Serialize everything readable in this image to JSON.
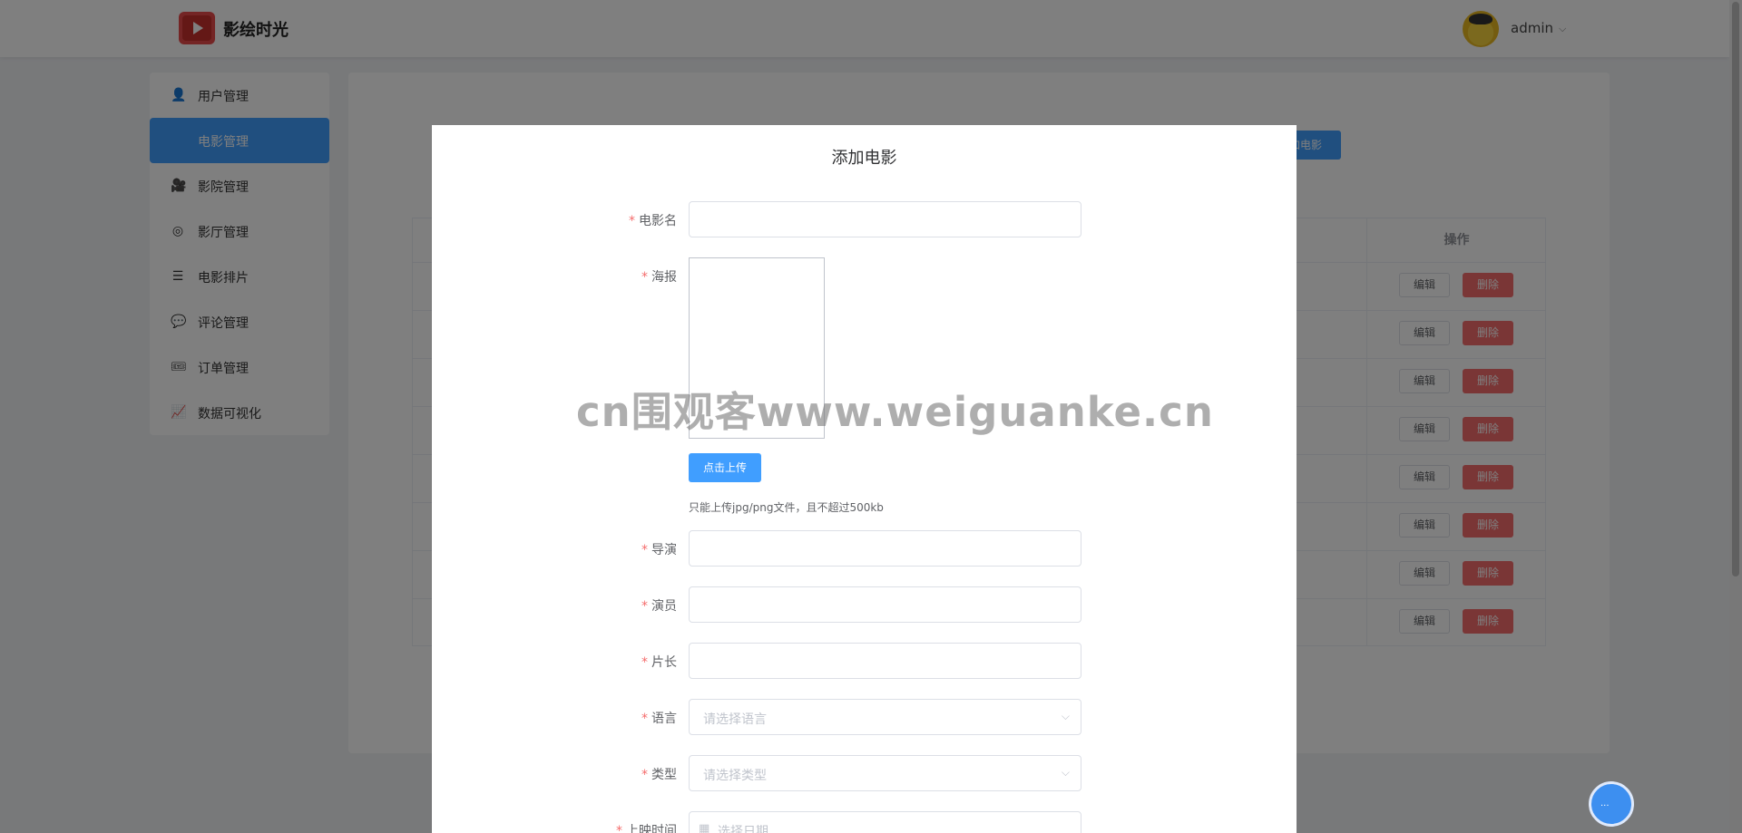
{
  "header": {
    "app_title": "影绘时光",
    "username": "admin",
    "caret": "⌵"
  },
  "sidebar": {
    "items": [
      {
        "label": "用户管理",
        "icon": "user-icon",
        "glyph": "👤"
      },
      {
        "label": "电影管理",
        "icon": "film-icon",
        "glyph": ""
      },
      {
        "label": "影院管理",
        "icon": "camera-icon",
        "glyph": "🎥"
      },
      {
        "label": "影厅管理",
        "icon": "hall-icon",
        "glyph": "◎"
      },
      {
        "label": "电影排片",
        "icon": "schedule-icon",
        "glyph": "☰"
      },
      {
        "label": "评论管理",
        "icon": "comment-icon",
        "glyph": "💬"
      },
      {
        "label": "订单管理",
        "icon": "ticket-icon",
        "glyph": "🎟"
      },
      {
        "label": "数据可视化",
        "icon": "chart-icon",
        "glyph": "📈"
      }
    ],
    "active_index": 1
  },
  "main": {
    "add_button": "加电影",
    "table": {
      "ops_header": "操作",
      "row_count": 8,
      "edit_label": "编辑",
      "delete_label": "删除"
    }
  },
  "dialog": {
    "title": "添加电影",
    "fields": {
      "name": {
        "label": "电影名",
        "value": ""
      },
      "poster": {
        "label": "海报",
        "upload_button": "点击上传",
        "tip": "只能上传jpg/png文件，且不超过500kb"
      },
      "director": {
        "label": "导演",
        "value": ""
      },
      "actors": {
        "label": "演员",
        "value": ""
      },
      "duration": {
        "label": "片长",
        "value": ""
      },
      "language": {
        "label": "语言",
        "placeholder": "请选择语言"
      },
      "genre": {
        "label": "类型",
        "placeholder": "请选择类型"
      },
      "release_date": {
        "label": "上映时间",
        "placeholder": "选择日期"
      }
    }
  },
  "watermark": "cn围观客www.weiguanke.cn"
}
